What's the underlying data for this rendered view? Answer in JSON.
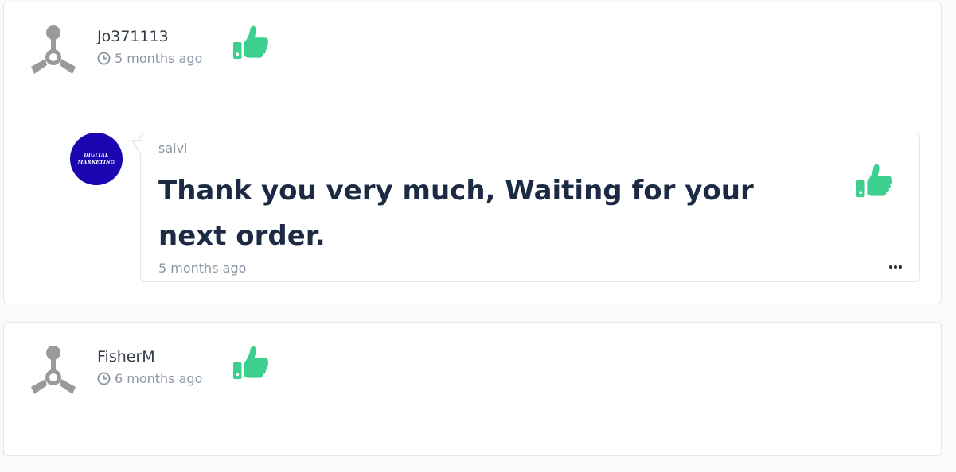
{
  "reviews": [
    {
      "user_name": "Jo371113",
      "time": "5 months ago",
      "reply": {
        "author": "salvi",
        "avatar_text": [
          "DIGITAL",
          "MARKETING"
        ],
        "text": "Thank you very much, Waiting for your next order.",
        "time": "5 months ago"
      }
    },
    {
      "user_name": "FisherM",
      "time": "6 months ago"
    }
  ],
  "colors": {
    "thumb": "#3ccf8e",
    "avatar_gray": "#9a9a9c",
    "reply_avatar_bg": "#1a05b0"
  },
  "icons": {
    "default_avatar": "user-placeholder-icon",
    "like": "thumbs-up-icon",
    "time": "clock-icon",
    "more": "more-dots-icon"
  }
}
